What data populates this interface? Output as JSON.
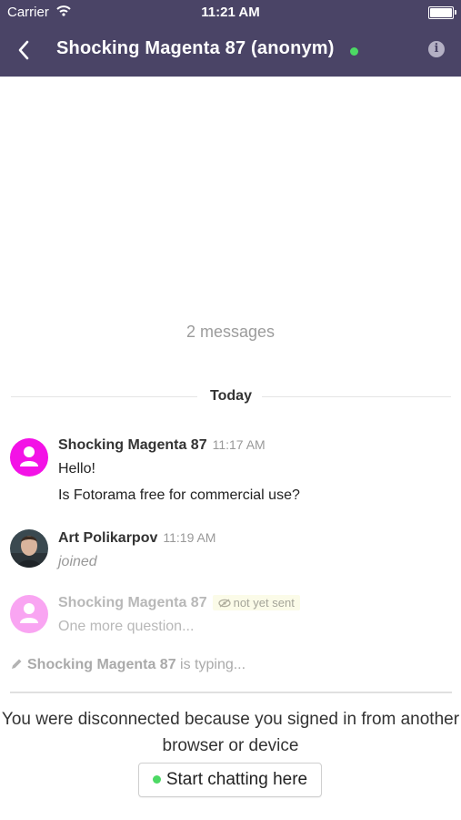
{
  "status_bar": {
    "carrier": "Carrier",
    "time": "11:21 AM"
  },
  "header": {
    "title": "Shocking Magenta 87 (anonym)"
  },
  "colors": {
    "header_bg": "#4a4466",
    "online": "#4cd964",
    "visitor_avatar": "#f312e6"
  },
  "icons": {
    "back": "chevron-left-icon",
    "info": "info-icon",
    "wifi": "wifi-icon",
    "battery": "battery-icon",
    "user": "user-icon",
    "eye": "eye-slash-icon",
    "pencil": "pencil-icon"
  },
  "conversation": {
    "count_label": "2 messages",
    "day_label": "Today",
    "messages": [
      {
        "author": "Shocking Magenta 87",
        "time": "11:17 AM",
        "lines": [
          "Hello!",
          "Is Fotorama free for commercial use?"
        ]
      },
      {
        "author": "Art Polikarpov",
        "time": "11:19 AM",
        "lines": [
          "joined"
        ]
      },
      {
        "author": "Shocking Magenta 87",
        "status": "not yet sent",
        "lines": [
          "One more question..."
        ]
      }
    ],
    "typing": {
      "author": "Shocking Magenta 87",
      "suffix": " is typing..."
    }
  },
  "footer": {
    "notice": "You were disconnected because you signed in from another browser or device",
    "button_label": "Start chatting here"
  }
}
